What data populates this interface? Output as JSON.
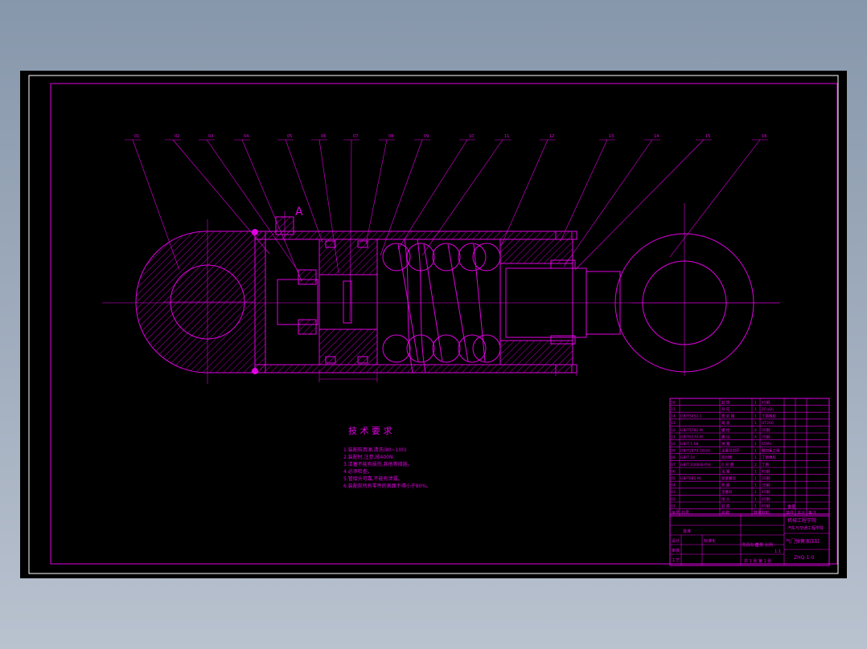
{
  "colors": {
    "line": "#e000e0",
    "background": "#000000",
    "white": "#ffffff"
  },
  "callouts": [
    "01",
    "02",
    "03",
    "04",
    "05",
    "06",
    "07",
    "08",
    "09",
    "10",
    "11",
    "12",
    "13",
    "14",
    "15",
    "16"
  ],
  "section_mark": "A",
  "tech_requirements": {
    "title": "技 术 要 求",
    "items": [
      "1.装配前用油,清洗(80~100)",
      "2.装配时,注意,按400N",
      "3.活塞不能有损伤,其他等措施。",
      "4.必须检查。",
      "5.管接头可靠,不能有泄漏。",
      "6.装配前所有零件的表面不得小于80%。"
    ]
  },
  "parts_table": {
    "rows": [
      {
        "no": "16",
        "code": "",
        "name": "缸 筒",
        "qty": "1",
        "mat": "45钢"
      },
      {
        "no": "15",
        "code": "",
        "name": "导 向",
        "qty": "1",
        "mat": "ZCuSn"
      },
      {
        "no": "14",
        "code": "GB/T3452-1",
        "name": "密 封 圈",
        "qty": "1",
        "mat": "丁腈橡胶"
      },
      {
        "no": "13",
        "code": "",
        "name": "端 盖",
        "qty": "1",
        "mat": "HT200"
      },
      {
        "no": "12",
        "code": "GB/T5782-M",
        "name": "螺 栓",
        "qty": "4",
        "mat": "35钢"
      },
      {
        "no": "11",
        "code": "GB/T6170-M",
        "name": "螺 母",
        "qty": "4",
        "mat": "35钢"
      },
      {
        "no": "10",
        "code": "GB/T 1-08",
        "name": "弹 簧",
        "qty": "1",
        "mat": "65Mn"
      },
      {
        "no": "09",
        "code": "GB/T2879-10/20",
        "name": "活塞导向环",
        "qty": "1",
        "mat": "聚四氟乙烯"
      },
      {
        "no": "08",
        "code": "GB/T 24",
        "name": "密封圈",
        "qty": "1",
        "mat": "丁腈橡胶"
      },
      {
        "no": "07",
        "code": "GB/T 2008-B-Y04",
        "name": "O 形 圈",
        "qty": "2",
        "mat": "丁腈"
      },
      {
        "no": "06",
        "code": "",
        "name": "活 塞",
        "qty": "1",
        "mat": "45钢"
      },
      {
        "no": "05",
        "code": "GB/T685-M",
        "name": "锁紧螺母",
        "qty": "1",
        "mat": "35钢"
      },
      {
        "no": "04",
        "code": "",
        "name": "垫 圈",
        "qty": "1",
        "mat": "35钢"
      },
      {
        "no": "03",
        "code": "",
        "name": "活塞杆",
        "qty": "1",
        "mat": "45钢"
      },
      {
        "no": "02",
        "code": "",
        "name": "接 头",
        "qty": "1",
        "mat": "45钢"
      },
      {
        "no": "01",
        "code": "",
        "name": "缸 底",
        "qty": "1",
        "mat": "45钢"
      }
    ],
    "header": [
      "序号",
      "代号",
      "名称",
      "数量",
      "材料",
      "单件",
      "总计",
      "备注"
    ],
    "weight_header": "重量"
  },
  "title_block": {
    "school": "机械工程学院",
    "subtitle": "汽车与交通工程学院",
    "drawing_title": "气门弹簧液压缸",
    "drawing_no": "ZHQ-1-0",
    "scale": "1:1",
    "sheet": "共 1 张 第 1 张",
    "labels": [
      "设计",
      "审核",
      "工艺",
      "批准",
      "标准化",
      "比例",
      "阶段标记",
      "重量"
    ]
  }
}
